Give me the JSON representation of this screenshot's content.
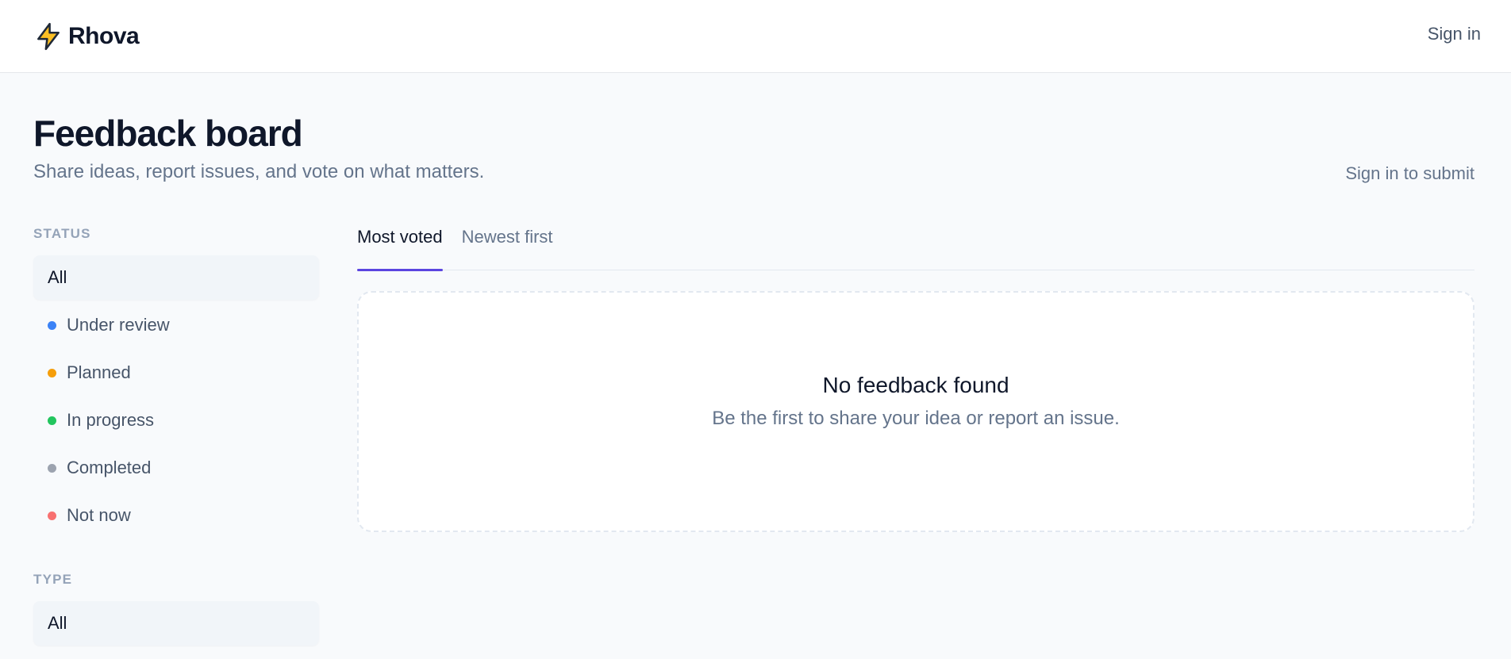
{
  "header": {
    "brand_name": "Rhova",
    "brand_icon": "lightning-bolt-icon",
    "signin_label": "Sign in"
  },
  "page": {
    "title": "Feedback board",
    "subtitle": "Share ideas, report issues, and vote on what matters.",
    "submit_label": "Sign in to submit"
  },
  "sidebar": {
    "status": {
      "label": "STATUS",
      "items": [
        {
          "label": "All",
          "active": true
        },
        {
          "label": "Under review",
          "color": "#3b82f6"
        },
        {
          "label": "Planned",
          "color": "#f59e0b"
        },
        {
          "label": "In progress",
          "color": "#22c55e"
        },
        {
          "label": "Completed",
          "color": "#9ca3af"
        },
        {
          "label": "Not now",
          "color": "#f87171"
        }
      ]
    },
    "type": {
      "label": "TYPE",
      "items": [
        {
          "label": "All",
          "active": true
        }
      ]
    }
  },
  "tabs": [
    {
      "label": "Most voted",
      "active": true
    },
    {
      "label": "Newest first"
    }
  ],
  "empty_state": {
    "title": "No feedback found",
    "text": "Be the first to share your idea or report an issue."
  },
  "colors": {
    "accent": "#5b45e0",
    "bolt_fill": "#fbbf24",
    "bolt_stroke": "#1f2937"
  }
}
